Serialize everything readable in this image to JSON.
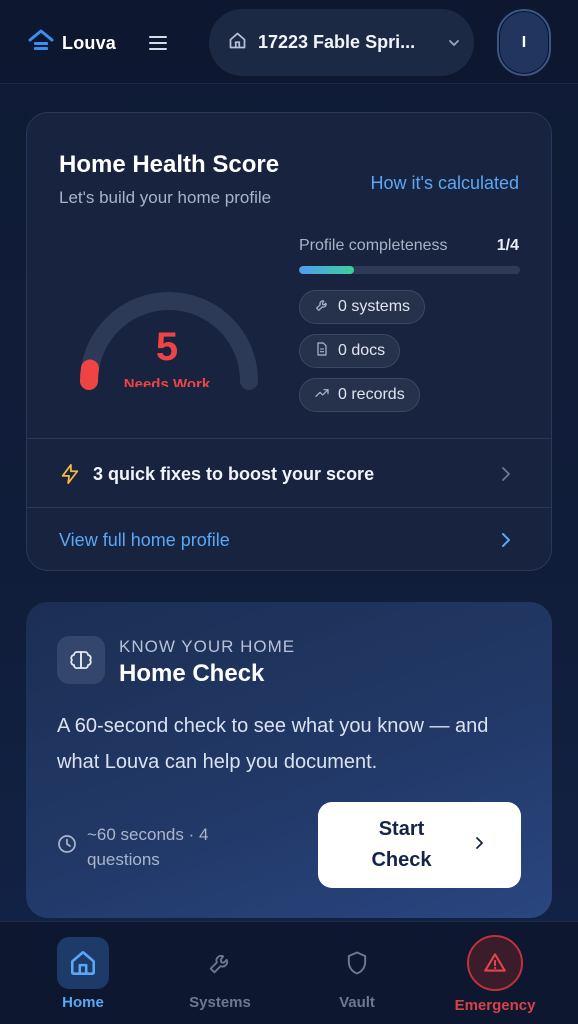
{
  "header": {
    "brand_name": "Louva",
    "address": "17223 Fable Spri...",
    "avatar_initial": "I"
  },
  "score_card": {
    "title": "Home Health Score",
    "subtitle": "Let's build your home profile",
    "how_link": "How it's calculated",
    "score": "5",
    "score_status": "Needs Work",
    "score_value": 5,
    "score_max": 100,
    "completeness_label": "Profile completeness",
    "completeness_value": "1/4",
    "completeness_fraction": 0.25,
    "chips": [
      {
        "label": "0 systems",
        "icon": "wrench-icon"
      },
      {
        "label": "0 docs",
        "icon": "document-icon"
      },
      {
        "label": "0 records",
        "icon": "trend-up-icon"
      }
    ],
    "quick_fixes": "3 quick fixes to boost your score",
    "view_profile": "View full home profile"
  },
  "home_check": {
    "eyebrow": "KNOW YOUR HOME",
    "title": "Home Check",
    "description": "A 60-second check to see what you know — and what Louva can help you document.",
    "time_estimate": "~60 seconds · 4 questions",
    "start_button": "Start Check"
  },
  "bottom_nav": {
    "items": [
      {
        "label": "Home",
        "icon": "home-icon",
        "active": true
      },
      {
        "label": "Systems",
        "icon": "wrench-icon",
        "active": false
      },
      {
        "label": "Vault",
        "icon": "shield-icon",
        "active": false
      },
      {
        "label": "Emergency",
        "icon": "warning-icon",
        "active": false
      }
    ]
  },
  "colors": {
    "accent_blue": "#5aa8f5",
    "danger_red": "#ef4444",
    "background": "#0f1a33"
  }
}
